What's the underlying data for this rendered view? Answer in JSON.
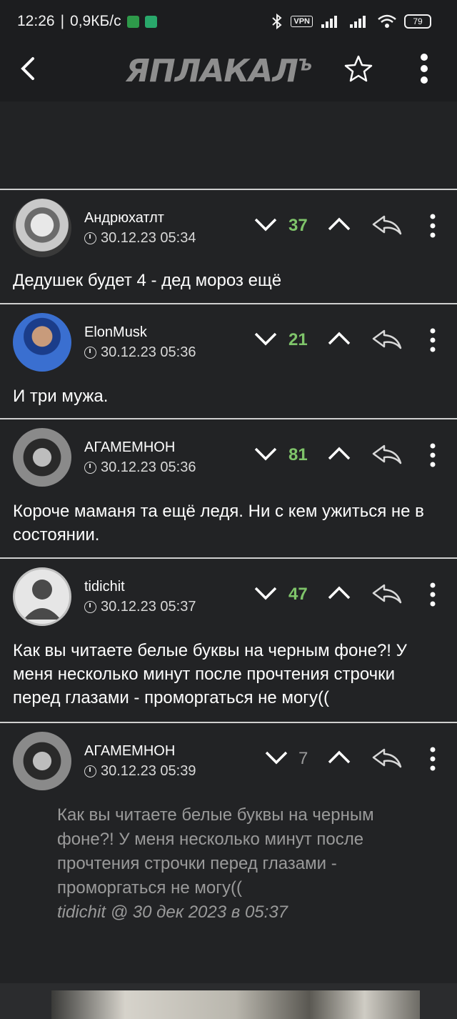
{
  "status_bar": {
    "time": "12:26",
    "speed": "0,9КБ/с",
    "vpn": "VPN",
    "battery": "79"
  },
  "app_bar": {
    "logo_text": "ЯПЛАКАЛ",
    "logo_sup": "Ъ"
  },
  "comments": [
    {
      "username": "Андрюхатлт",
      "time": "30.12.23 05:34",
      "score": "37",
      "text": "Дедушек будет 4 - дед мороз ещё"
    },
    {
      "username": "ElonMusk",
      "time": "30.12.23 05:36",
      "score": "21",
      "text": "И три мужа."
    },
    {
      "username": "АГАМЕМНОН",
      "time": "30.12.23 05:36",
      "score": "81",
      "text": "Короче маманя та ещё ледя. Ни с кем ужиться не в состоянии."
    },
    {
      "username": "tidichit",
      "time": "30.12.23 05:37",
      "score": "47",
      "text": "Как вы читаете белые буквы на черным фоне?! У меня несколько минут после прочтения строчки перед глазами - проморгаться не могу(("
    },
    {
      "username": "АГАМЕМНОН",
      "time": "30.12.23 05:39",
      "score": "7",
      "quote_text": "Как вы читаете белые буквы на черным фоне?! У меня несколько минут после прочтения строчки перед глазами - проморгаться не могу((",
      "quote_attrib": "tidichit @ 30 дек 2023 в 05:37"
    }
  ],
  "colors": {
    "background": "#222325",
    "score_positive": "#7fc46a",
    "score_neutral": "#9a9a9a"
  }
}
